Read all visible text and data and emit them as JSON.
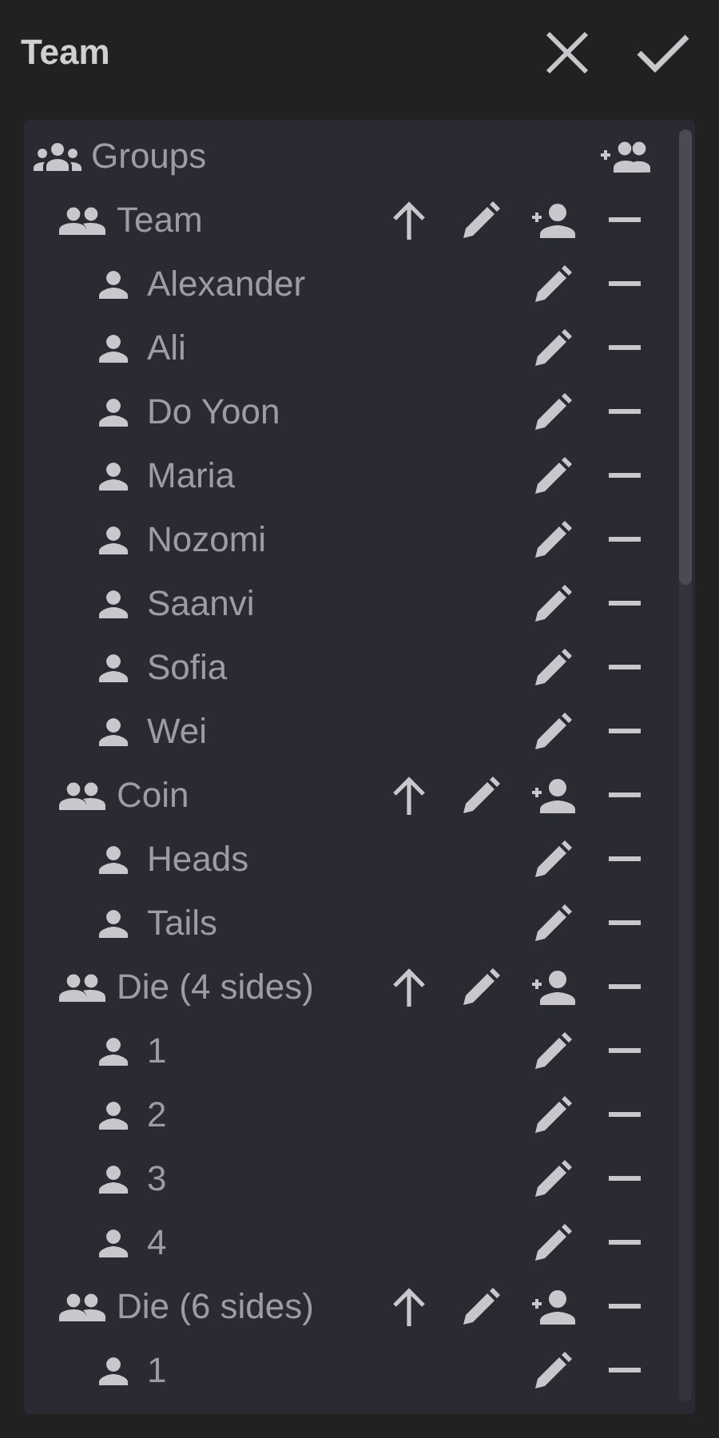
{
  "header": {
    "title": "Team"
  },
  "tree": {
    "label": "Groups",
    "kind": "root",
    "children": [
      {
        "label": "Team",
        "kind": "group",
        "children": [
          {
            "label": "Alexander",
            "kind": "member"
          },
          {
            "label": "Ali",
            "kind": "member"
          },
          {
            "label": "Do Yoon",
            "kind": "member"
          },
          {
            "label": "Maria",
            "kind": "member"
          },
          {
            "label": "Nozomi",
            "kind": "member"
          },
          {
            "label": "Saanvi",
            "kind": "member"
          },
          {
            "label": "Sofia",
            "kind": "member"
          },
          {
            "label": "Wei",
            "kind": "member"
          }
        ]
      },
      {
        "label": "Coin",
        "kind": "group",
        "children": [
          {
            "label": "Heads",
            "kind": "member"
          },
          {
            "label": "Tails",
            "kind": "member"
          }
        ]
      },
      {
        "label": "Die (4 sides)",
        "kind": "group",
        "children": [
          {
            "label": "1",
            "kind": "member"
          },
          {
            "label": "2",
            "kind": "member"
          },
          {
            "label": "3",
            "kind": "member"
          },
          {
            "label": "4",
            "kind": "member"
          }
        ]
      },
      {
        "label": "Die (6 sides)",
        "kind": "group",
        "children": [
          {
            "label": "1",
            "kind": "member"
          }
        ]
      }
    ]
  }
}
